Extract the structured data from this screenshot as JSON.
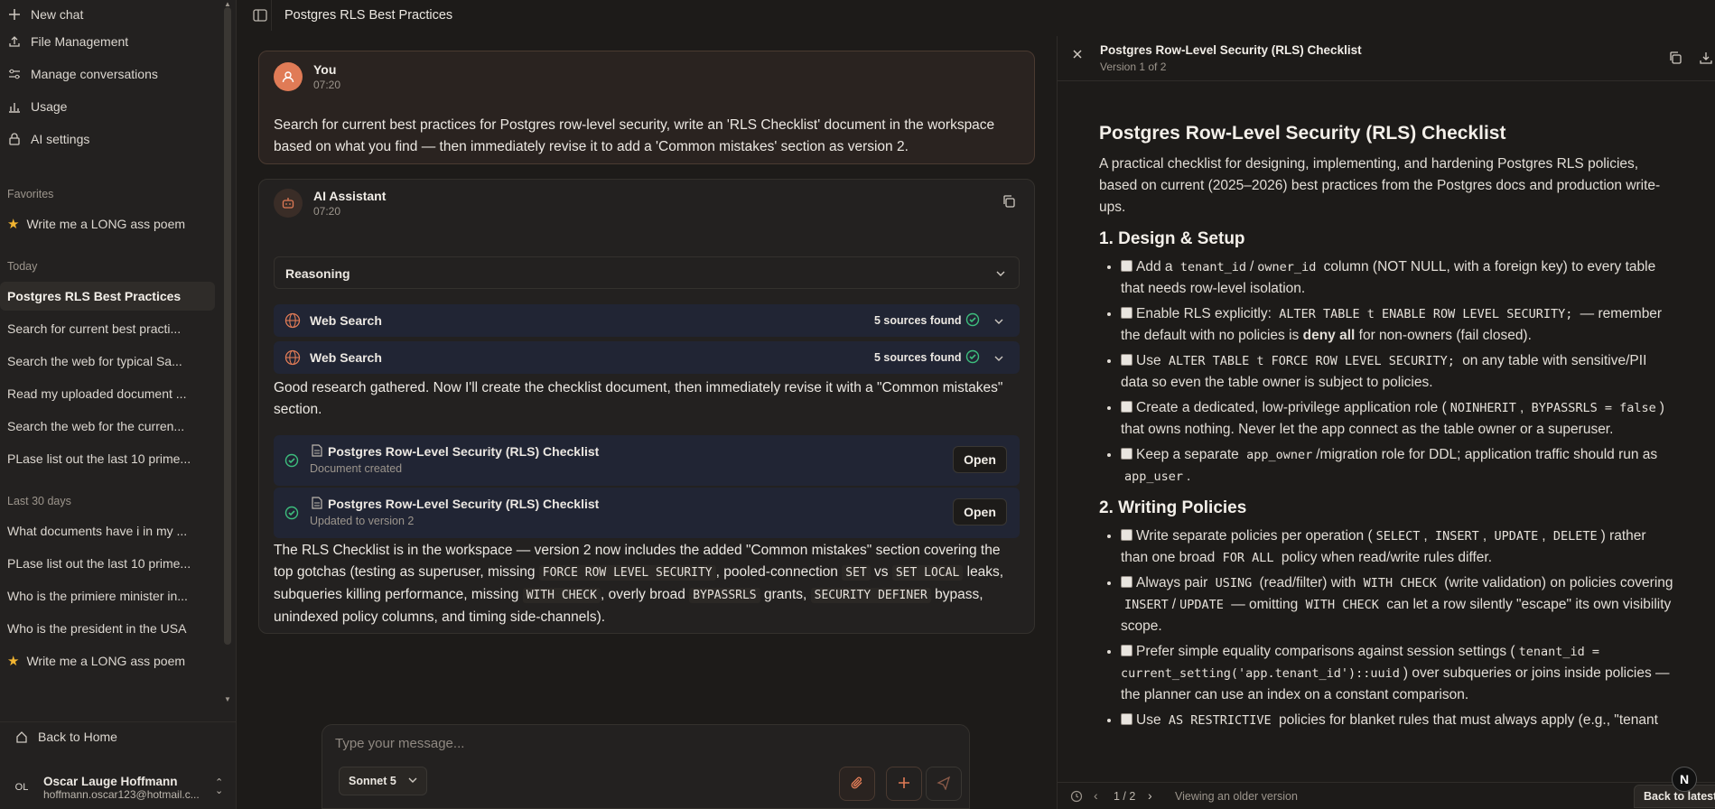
{
  "sidebar": {
    "nav": [
      {
        "label": "New chat",
        "icon": "plus-icon"
      },
      {
        "label": "File Management",
        "icon": "upload-icon"
      },
      {
        "label": "Manage conversations",
        "icon": "sliders-icon"
      },
      {
        "label": "Usage",
        "icon": "bar-chart-icon"
      },
      {
        "label": "AI settings",
        "icon": "lock-icon"
      }
    ],
    "favorites_heading": "Favorites",
    "favorites": [
      "Write me a LONG ass poem"
    ],
    "today_heading": "Today",
    "today": [
      "Postgres RLS Best Practices",
      "Search for current best practi...",
      "Search the web for typical Sa...",
      "Read my uploaded document ...",
      "Search the web for the curren...",
      "PLase list out the last 10 prime..."
    ],
    "last30_heading": "Last 30 days",
    "last30": [
      "What documents have i in my ...",
      "PLase list out the last 10 prime...",
      "Who is the primiere minister in...",
      "Who is the president in the USA",
      "Write me a LONG ass poem"
    ],
    "back_home": "Back to Home",
    "user": {
      "initials": "OL",
      "name": "Oscar Lauge Hoffmann",
      "email": "hoffmann.oscar123@hotmail.c..."
    }
  },
  "header": {
    "title": "Postgres RLS Best Practices"
  },
  "chat": {
    "user_msg": {
      "name": "You",
      "time": "07:20",
      "text": "Search for current best practices for Postgres row-level security, write an 'RLS Checklist' document in the workspace based on what you find — then immediately revise it to add a 'Common mistakes' section as version 2."
    },
    "ai_msg": {
      "name": "AI Assistant",
      "time": "07:20",
      "reasoning_label": "Reasoning",
      "searches": [
        {
          "label": "Web Search",
          "count": "5 sources found"
        },
        {
          "label": "Web Search",
          "count": "5 sources found"
        }
      ],
      "text1": "Good research gathered. Now I'll create the checklist document, then immediately revise it with a \"Common mistakes\" section.",
      "docs": [
        {
          "title": "Postgres Row-Level Security (RLS) Checklist",
          "sub": "Document created",
          "btn": "Open"
        },
        {
          "title": "Postgres Row-Level Security (RLS) Checklist",
          "sub": "Updated to version 2",
          "btn": "Open"
        }
      ],
      "final": {
        "a": "The RLS Checklist is in the workspace — version 2 now includes the added \"Common mistakes\" section covering the top gotchas (testing as superuser, missing ",
        "c1": "FORCE ROW LEVEL SECURITY",
        "b": ", pooled-connection ",
        "c2": "SET",
        "vs": " vs ",
        "c3": "SET LOCAL",
        "c": " leaks, subqueries killing performance, missing ",
        "c4": "WITH CHECK",
        "d": ", overly broad ",
        "c5": "BYPASSRLS",
        "e": " grants, ",
        "c6": "SECURITY DEFINER",
        "f": " bypass, unindexed policy columns, and timing side-channels)."
      }
    }
  },
  "composer": {
    "placeholder": "Type your message...",
    "model": "Sonnet 5"
  },
  "panel": {
    "title": "Postgres Row-Level Security (RLS) Checklist",
    "version": "Version 1 of 2",
    "doc_title": "Postgres Row-Level Security (RLS) Checklist",
    "intro": "A practical checklist for designing, implementing, and hardening Postgres RLS policies, based on current (2025–2026) best practices from the Postgres docs and production write-ups.",
    "s1": "1. Design & Setup",
    "s1_items": {
      "i1a": "Add a",
      "i1k1": "tenant_id",
      "i1s": "/",
      "i1k2": "owner_id",
      "i1b": "column (NOT NULL, with a foreign key) to every table that needs row-level isolation.",
      "i2a": "Enable RLS explicitly:",
      "i2k": "ALTER TABLE t ENABLE ROW LEVEL SECURITY;",
      "i2b": "— remember the default with no policies is",
      "i2strong": "deny all",
      "i2c": "for non-owners (fail closed).",
      "i3a": "Use",
      "i3k": "ALTER TABLE t FORCE ROW LEVEL SECURITY;",
      "i3b": "on any table with sensitive/PII data so even the table owner is subject to policies.",
      "i4a": "Create a dedicated, low-privilege application role (",
      "i4k1": "NOINHERIT",
      "i4k2": "BYPASSRLS = false",
      "i4b": ") that owns nothing. Never let the app connect as the table owner or a superuser.",
      "i5a": "Keep a separate",
      "i5k1": "app_owner",
      "i5b": "/migration role for DDL; application traffic should run as",
      "i5k2": "app_user",
      "i5c": "."
    },
    "s2": "2. Writing Policies",
    "s2_items": {
      "j1a": "Write separate policies per operation (",
      "j1k1": "SELECT",
      "j1k2": "INSERT",
      "j1k3": "UPDATE",
      "j1k4": "DELETE",
      "j1b": ") rather than one broad",
      "j1k5": "FOR ALL",
      "j1c": "policy when read/write rules differ.",
      "j2a": "Always pair",
      "j2k1": "USING",
      "j2b": "(read/filter) with",
      "j2k2": "WITH CHECK",
      "j2c": "(write validation) on policies covering",
      "j2k3": "INSERT",
      "j2s": "/",
      "j2k4": "UPDATE",
      "j2d": "— omitting",
      "j2k5": "WITH CHECK",
      "j2e": "can let a row silently \"escape\" its own visibility scope.",
      "j3a": "Prefer simple equality comparisons against session settings (",
      "j3k": "tenant_id = current_setting('app.tenant_id')::uuid",
      "j3b": ") over subqueries or joins inside policies — the planner can use an index on a constant comparison.",
      "j4a": "Use",
      "j4k": "AS RESTRICTIVE",
      "j4b": "policies for blanket rules that must always apply (e.g., \"tenant"
    },
    "footer": {
      "pager": "1 / 2",
      "status": "Viewing an older version",
      "back_latest": "Back to latest"
    }
  },
  "colors": {
    "accent": "#e07b56",
    "success": "#3dbd7d",
    "star": "#f2b531",
    "tool_bg": "#212534"
  }
}
